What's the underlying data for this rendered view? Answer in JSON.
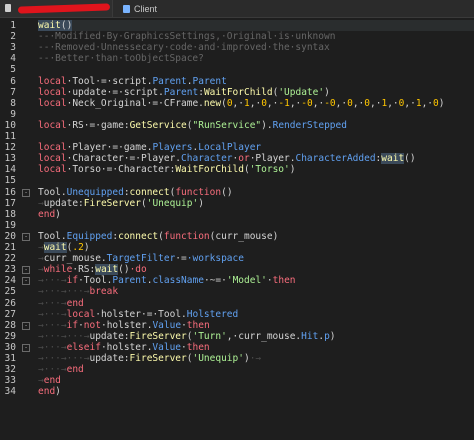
{
  "tabs": [
    {
      "label": ""
    },
    {
      "label": "Client"
    }
  ],
  "gutter": {
    "numbers": [
      "1",
      "2",
      "3",
      "4",
      "5",
      "6",
      "7",
      "8",
      "9",
      "10",
      "11",
      "12",
      "13",
      "14",
      "15",
      "16",
      "17",
      "18",
      "19",
      "20",
      "21",
      "22",
      "23",
      "24",
      "25",
      "26",
      "27",
      "28",
      "29",
      "30",
      "31",
      "32",
      "33",
      "34"
    ]
  },
  "code_lines": [
    [
      {
        "t": "wait",
        "c": "fn hlw"
      },
      {
        "t": "()",
        "c": "hlw"
      }
    ],
    [
      {
        "t": "--·Modified·By·GraphicsSettings,·Original·is·unknown",
        "c": "cm"
      }
    ],
    [
      {
        "t": "--·Removed·Unnessecary·code·and·improved·the·syntax",
        "c": "cm"
      }
    ],
    [
      {
        "t": "--·Better·than·toObjectSpace?",
        "c": "cm"
      }
    ],
    [],
    [
      {
        "t": "local",
        "c": "kw"
      },
      {
        "t": "·Tool·",
        "c": ""
      },
      {
        "t": "=",
        "c": "op"
      },
      {
        "t": "·script.",
        "c": ""
      },
      {
        "t": "Parent",
        "c": "prop"
      },
      {
        "t": ".",
        "c": ""
      },
      {
        "t": "Parent",
        "c": "prop"
      }
    ],
    [
      {
        "t": "local",
        "c": "kw"
      },
      {
        "t": "·update·",
        "c": ""
      },
      {
        "t": "=",
        "c": "op"
      },
      {
        "t": "·script.",
        "c": ""
      },
      {
        "t": "Parent",
        "c": "prop"
      },
      {
        "t": ":",
        "c": ""
      },
      {
        "t": "WaitForChild",
        "c": "fn"
      },
      {
        "t": "(",
        "c": ""
      },
      {
        "t": "'Update'",
        "c": "str"
      },
      {
        "t": ")",
        "c": ""
      }
    ],
    [
      {
        "t": "local",
        "c": "kw"
      },
      {
        "t": "·Neck_Original·",
        "c": ""
      },
      {
        "t": "=",
        "c": "op"
      },
      {
        "t": "·CFrame.",
        "c": ""
      },
      {
        "t": "new",
        "c": "fn"
      },
      {
        "t": "(",
        "c": ""
      },
      {
        "t": "0",
        "c": "num"
      },
      {
        "t": ",·",
        "c": ""
      },
      {
        "t": "1",
        "c": "num"
      },
      {
        "t": ",·",
        "c": ""
      },
      {
        "t": "0",
        "c": "num"
      },
      {
        "t": ",·",
        "c": ""
      },
      {
        "t": "-1",
        "c": "num"
      },
      {
        "t": ",·",
        "c": ""
      },
      {
        "t": "-0",
        "c": "num"
      },
      {
        "t": ",·",
        "c": ""
      },
      {
        "t": "-0",
        "c": "num"
      },
      {
        "t": ",·",
        "c": ""
      },
      {
        "t": "0",
        "c": "num"
      },
      {
        "t": ",·",
        "c": ""
      },
      {
        "t": "0",
        "c": "num"
      },
      {
        "t": ",·",
        "c": ""
      },
      {
        "t": "1",
        "c": "num"
      },
      {
        "t": ",·",
        "c": ""
      },
      {
        "t": "0",
        "c": "num"
      },
      {
        "t": ",·",
        "c": ""
      },
      {
        "t": "1",
        "c": "num"
      },
      {
        "t": ",·",
        "c": ""
      },
      {
        "t": "0",
        "c": "num"
      },
      {
        "t": ")",
        "c": ""
      }
    ],
    [],
    [
      {
        "t": "local",
        "c": "kw"
      },
      {
        "t": "·RS·",
        "c": ""
      },
      {
        "t": "=",
        "c": "op"
      },
      {
        "t": "·game:",
        "c": ""
      },
      {
        "t": "GetService",
        "c": "fn"
      },
      {
        "t": "(",
        "c": ""
      },
      {
        "t": "\"RunService\"",
        "c": "str"
      },
      {
        "t": ").",
        "c": ""
      },
      {
        "t": "RenderStepped",
        "c": "prop"
      }
    ],
    [],
    [
      {
        "t": "local",
        "c": "kw"
      },
      {
        "t": "·Player·",
        "c": ""
      },
      {
        "t": "=",
        "c": "op"
      },
      {
        "t": "·game.",
        "c": ""
      },
      {
        "t": "Players",
        "c": "prop"
      },
      {
        "t": ".",
        "c": ""
      },
      {
        "t": "LocalPlayer",
        "c": "prop"
      }
    ],
    [
      {
        "t": "local",
        "c": "kw"
      },
      {
        "t": "·Character·",
        "c": ""
      },
      {
        "t": "=",
        "c": "op"
      },
      {
        "t": "·Player.",
        "c": ""
      },
      {
        "t": "Character",
        "c": "prop"
      },
      {
        "t": "·",
        "c": ""
      },
      {
        "t": "or",
        "c": "kw"
      },
      {
        "t": "·Player.",
        "c": ""
      },
      {
        "t": "CharacterAdded",
        "c": "prop"
      },
      {
        "t": ":",
        "c": ""
      },
      {
        "t": "wait",
        "c": "fn hlw"
      },
      {
        "t": "()",
        "c": ""
      }
    ],
    [
      {
        "t": "local",
        "c": "kw"
      },
      {
        "t": "·Torso·",
        "c": ""
      },
      {
        "t": "=",
        "c": "op"
      },
      {
        "t": "·Character:",
        "c": ""
      },
      {
        "t": "WaitForChild",
        "c": "fn"
      },
      {
        "t": "(",
        "c": ""
      },
      {
        "t": "'Torso'",
        "c": "str"
      },
      {
        "t": ")",
        "c": ""
      }
    ],
    [],
    [
      {
        "t": "Tool.",
        "c": ""
      },
      {
        "t": "Unequipped",
        "c": "prop"
      },
      {
        "t": ":",
        "c": ""
      },
      {
        "t": "connect",
        "c": "fn"
      },
      {
        "t": "(",
        "c": ""
      },
      {
        "t": "function",
        "c": "kw"
      },
      {
        "t": "()",
        "c": ""
      }
    ],
    [
      {
        "t": "→",
        "c": "indent"
      },
      {
        "t": "update:",
        "c": ""
      },
      {
        "t": "FireServer",
        "c": "fn"
      },
      {
        "t": "(",
        "c": ""
      },
      {
        "t": "'Unequip'",
        "c": "str"
      },
      {
        "t": ")",
        "c": ""
      }
    ],
    [
      {
        "t": "end",
        "c": "kw"
      },
      {
        "t": ")",
        "c": ""
      }
    ],
    [],
    [
      {
        "t": "Tool.",
        "c": ""
      },
      {
        "t": "Equipped",
        "c": "prop"
      },
      {
        "t": ":",
        "c": ""
      },
      {
        "t": "connect",
        "c": "fn"
      },
      {
        "t": "(",
        "c": ""
      },
      {
        "t": "function",
        "c": "kw"
      },
      {
        "t": "(curr_mouse)",
        "c": ""
      }
    ],
    [
      {
        "t": "→",
        "c": "indent"
      },
      {
        "t": "wait",
        "c": "fn hlw"
      },
      {
        "t": "(",
        "c": ""
      },
      {
        "t": ".2",
        "c": "num"
      },
      {
        "t": ")",
        "c": ""
      }
    ],
    [
      {
        "t": "→",
        "c": "indent"
      },
      {
        "t": "curr_mouse.",
        "c": ""
      },
      {
        "t": "TargetFilter",
        "c": "prop"
      },
      {
        "t": "·",
        "c": ""
      },
      {
        "t": "=",
        "c": "op"
      },
      {
        "t": "·workspace",
        "c": "prop"
      }
    ],
    [
      {
        "t": "→",
        "c": "indent"
      },
      {
        "t": "while",
        "c": "kw"
      },
      {
        "t": "·RS:",
        "c": ""
      },
      {
        "t": "wait",
        "c": "fn hlw"
      },
      {
        "t": "()",
        "c": ""
      },
      {
        "t": "·do",
        "c": "kw"
      }
    ],
    [
      {
        "t": "→···→",
        "c": "indent"
      },
      {
        "t": "if",
        "c": "kw"
      },
      {
        "t": "·Tool.",
        "c": ""
      },
      {
        "t": "Parent",
        "c": "prop"
      },
      {
        "t": ".",
        "c": ""
      },
      {
        "t": "className",
        "c": "prop"
      },
      {
        "t": "·",
        "c": ""
      },
      {
        "t": "~=",
        "c": "op"
      },
      {
        "t": "·",
        "c": ""
      },
      {
        "t": "'Model'",
        "c": "str"
      },
      {
        "t": "·",
        "c": ""
      },
      {
        "t": "then",
        "c": "kw"
      }
    ],
    [
      {
        "t": "→···→···→",
        "c": "indent"
      },
      {
        "t": "break",
        "c": "kw"
      }
    ],
    [
      {
        "t": "→···→",
        "c": "indent"
      },
      {
        "t": "end",
        "c": "kw"
      }
    ],
    [
      {
        "t": "→···→",
        "c": "indent"
      },
      {
        "t": "local",
        "c": "kw"
      },
      {
        "t": "·holster·",
        "c": ""
      },
      {
        "t": "=",
        "c": "op"
      },
      {
        "t": "·Tool.",
        "c": ""
      },
      {
        "t": "Holstered",
        "c": "prop"
      }
    ],
    [
      {
        "t": "→···→",
        "c": "indent"
      },
      {
        "t": "if",
        "c": "kw"
      },
      {
        "t": "·",
        "c": ""
      },
      {
        "t": "not",
        "c": "kw"
      },
      {
        "t": "·holster.",
        "c": ""
      },
      {
        "t": "Value",
        "c": "prop"
      },
      {
        "t": "·",
        "c": ""
      },
      {
        "t": "then",
        "c": "kw"
      }
    ],
    [
      {
        "t": "→···→···→",
        "c": "indent"
      },
      {
        "t": "update:",
        "c": ""
      },
      {
        "t": "FireServer",
        "c": "fn"
      },
      {
        "t": "(",
        "c": ""
      },
      {
        "t": "'Turn'",
        "c": "str"
      },
      {
        "t": ",·curr_mouse.",
        "c": ""
      },
      {
        "t": "Hit",
        "c": "prop"
      },
      {
        "t": ".",
        "c": ""
      },
      {
        "t": "p",
        "c": "prop"
      },
      {
        "t": ")",
        "c": ""
      }
    ],
    [
      {
        "t": "→···→",
        "c": "indent"
      },
      {
        "t": "elseif",
        "c": "kw"
      },
      {
        "t": "·holster.",
        "c": ""
      },
      {
        "t": "Value",
        "c": "prop"
      },
      {
        "t": "·",
        "c": ""
      },
      {
        "t": "then",
        "c": "kw"
      }
    ],
    [
      {
        "t": "→···→···→",
        "c": "indent"
      },
      {
        "t": "update:",
        "c": ""
      },
      {
        "t": "FireServer",
        "c": "fn"
      },
      {
        "t": "(",
        "c": ""
      },
      {
        "t": "'Unequip'",
        "c": "str"
      },
      {
        "t": ")",
        "c": ""
      },
      {
        "t": "·→",
        "c": "indent"
      }
    ],
    [
      {
        "t": "→···→",
        "c": "indent"
      },
      {
        "t": "end",
        "c": "kw"
      }
    ],
    [
      {
        "t": "→",
        "c": "indent"
      },
      {
        "t": "end",
        "c": "kw"
      }
    ],
    [
      {
        "t": "end",
        "c": "kw"
      },
      {
        "t": ")",
        "c": ""
      }
    ]
  ]
}
